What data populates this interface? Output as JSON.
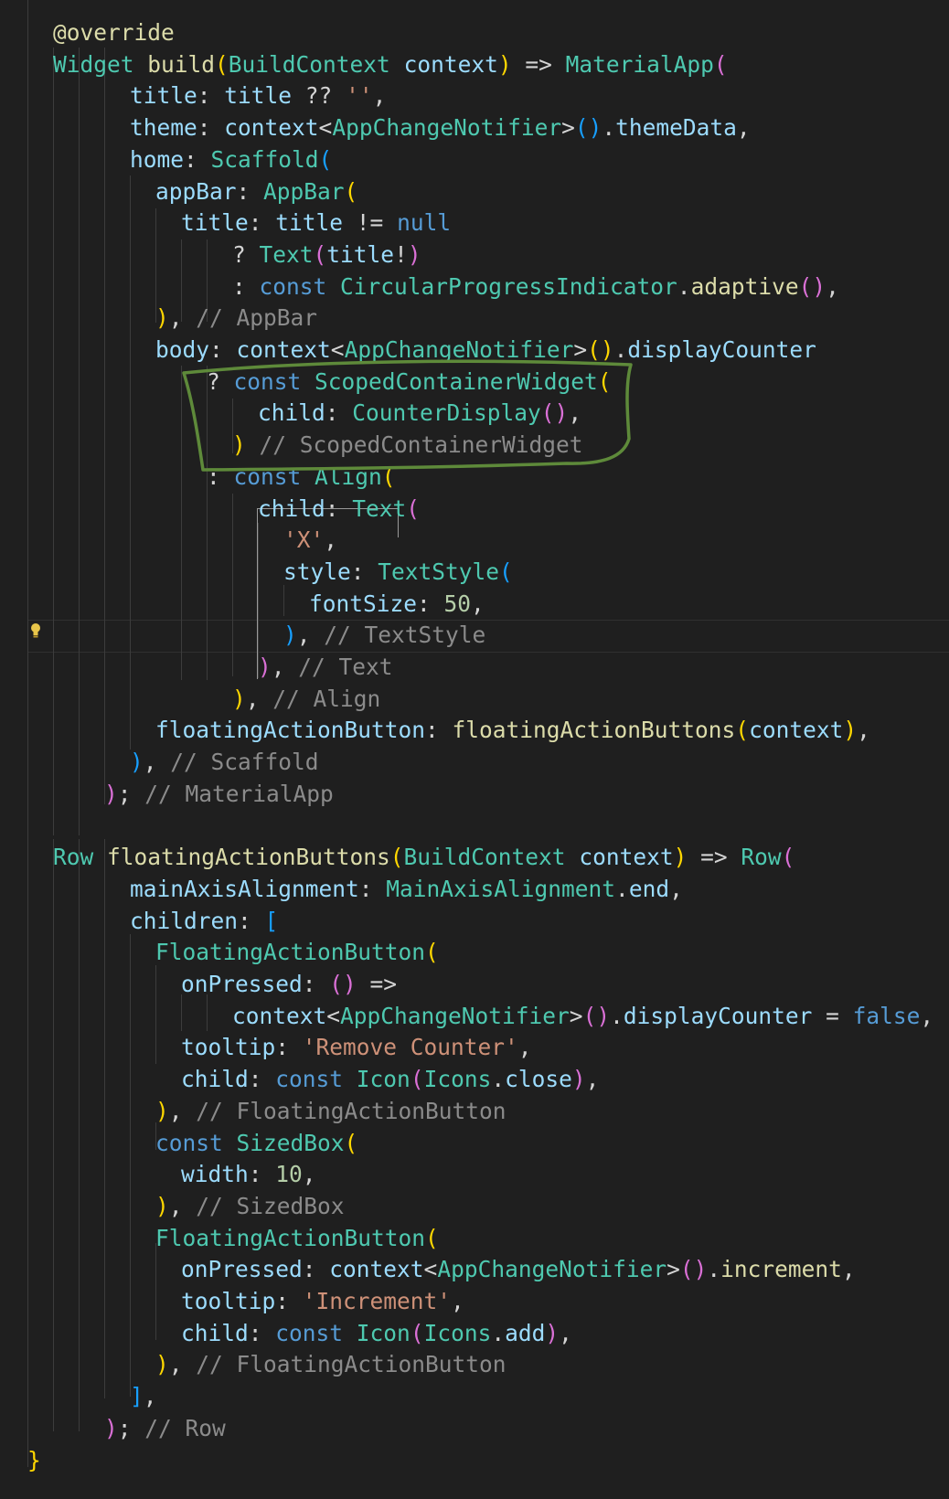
{
  "editor": {
    "language": "dart",
    "colors": {
      "background": "#1f1f1f",
      "keyword": "#569cd6",
      "type": "#4ec9b0",
      "function": "#dcdcaa",
      "variable": "#9cdcfe",
      "string": "#ce9178",
      "number": "#b5cea8",
      "comment": "#8b8b8b",
      "annotation_stroke": "#5e8a3a"
    },
    "lines": [
      [
        [
          "@override",
          "tok-fn"
        ]
      ],
      [
        [
          "Widget ",
          "tok-type"
        ],
        [
          "build",
          "tok-fn"
        ],
        [
          "(",
          "tok-p1"
        ],
        [
          "BuildContext ",
          "tok-type"
        ],
        [
          "context",
          "tok-var"
        ],
        [
          ") ",
          "tok-p1"
        ],
        [
          "=> ",
          "tok-plain"
        ],
        [
          "MaterialApp",
          "tok-type"
        ],
        [
          "(",
          "tok-p2"
        ]
      ],
      [
        [
          "title",
          "tok-var"
        ],
        [
          ": ",
          "tok-plain"
        ],
        [
          "title ",
          "tok-var"
        ],
        [
          "?? ",
          "tok-plain"
        ],
        [
          "''",
          "tok-str"
        ],
        [
          ",",
          "tok-plain"
        ]
      ],
      [
        [
          "theme",
          "tok-var"
        ],
        [
          ": ",
          "tok-plain"
        ],
        [
          "context",
          "tok-var"
        ],
        [
          "<",
          "tok-plain"
        ],
        [
          "AppChangeNotifier",
          "tok-type"
        ],
        [
          ">",
          "tok-plain"
        ],
        [
          "()",
          "tok-p3"
        ],
        [
          ".",
          "tok-plain"
        ],
        [
          "themeData",
          "tok-var"
        ],
        [
          ",",
          "tok-plain"
        ]
      ],
      [
        [
          "home",
          "tok-var"
        ],
        [
          ": ",
          "tok-plain"
        ],
        [
          "Scaffold",
          "tok-type"
        ],
        [
          "(",
          "tok-p3"
        ]
      ],
      [
        [
          "appBar",
          "tok-var"
        ],
        [
          ": ",
          "tok-plain"
        ],
        [
          "AppBar",
          "tok-type"
        ],
        [
          "(",
          "tok-p1"
        ]
      ],
      [
        [
          "title",
          "tok-var"
        ],
        [
          ": ",
          "tok-plain"
        ],
        [
          "title ",
          "tok-var"
        ],
        [
          "!= ",
          "tok-plain"
        ],
        [
          "null",
          "tok-kw"
        ]
      ],
      [
        [
          "? ",
          "tok-plain"
        ],
        [
          "Text",
          "tok-type"
        ],
        [
          "(",
          "tok-p2"
        ],
        [
          "title",
          "tok-var"
        ],
        [
          "!",
          "tok-plain"
        ],
        [
          ")",
          "tok-p2"
        ]
      ],
      [
        [
          ": ",
          "tok-plain"
        ],
        [
          "const ",
          "tok-kw"
        ],
        [
          "CircularProgressIndicator",
          "tok-type"
        ],
        [
          ".",
          "tok-plain"
        ],
        [
          "adaptive",
          "tok-fn"
        ],
        [
          "()",
          "tok-p2"
        ],
        [
          ",",
          "tok-plain"
        ]
      ],
      [
        [
          ")",
          "tok-p1"
        ],
        [
          ", ",
          "tok-plain"
        ],
        [
          "// AppBar",
          "tok-cmt"
        ]
      ],
      [
        [
          "body",
          "tok-var"
        ],
        [
          ": ",
          "tok-plain"
        ],
        [
          "context",
          "tok-var"
        ],
        [
          "<",
          "tok-plain"
        ],
        [
          "AppChangeNotifier",
          "tok-type"
        ],
        [
          ">",
          "tok-plain"
        ],
        [
          "()",
          "tok-p1"
        ],
        [
          ".",
          "tok-plain"
        ],
        [
          "displayCounter",
          "tok-var"
        ]
      ],
      [
        [
          "? ",
          "tok-plain"
        ],
        [
          "const ",
          "tok-kw"
        ],
        [
          "ScopedContainerWidget",
          "tok-type"
        ],
        [
          "(",
          "tok-p1"
        ]
      ],
      [
        [
          "child",
          "tok-var"
        ],
        [
          ": ",
          "tok-plain"
        ],
        [
          "CounterDisplay",
          "tok-type"
        ],
        [
          "()",
          "tok-p2"
        ],
        [
          ",",
          "tok-plain"
        ]
      ],
      [
        [
          ")",
          "tok-p1"
        ],
        [
          " ",
          "tok-plain"
        ],
        [
          "// ScopedContainerWidget",
          "tok-cmt"
        ]
      ],
      [
        [
          ": ",
          "tok-plain"
        ],
        [
          "const ",
          "tok-kw"
        ],
        [
          "Align",
          "tok-type"
        ],
        [
          "(",
          "tok-p1"
        ]
      ],
      [
        [
          "child",
          "tok-var"
        ],
        [
          ": ",
          "tok-plain"
        ],
        [
          "Text",
          "tok-type"
        ],
        [
          "(",
          "tok-p2"
        ]
      ],
      [
        [
          "'X'",
          "tok-str"
        ],
        [
          ",",
          "tok-plain"
        ]
      ],
      [
        [
          "style",
          "tok-var"
        ],
        [
          ": ",
          "tok-plain"
        ],
        [
          "TextStyle",
          "tok-type"
        ],
        [
          "(",
          "tok-p3"
        ]
      ],
      [
        [
          "fontSize",
          "tok-var"
        ],
        [
          ": ",
          "tok-plain"
        ],
        [
          "50",
          "tok-num"
        ],
        [
          ",",
          "tok-plain"
        ]
      ],
      [
        [
          ")",
          "tok-p3"
        ],
        [
          ", ",
          "tok-plain"
        ],
        [
          "// TextStyle",
          "tok-cmt"
        ]
      ],
      [
        [
          ")",
          "tok-p2"
        ],
        [
          ", ",
          "tok-plain"
        ],
        [
          "// Text",
          "tok-cmt"
        ]
      ],
      [
        [
          ")",
          "tok-p1"
        ],
        [
          ", ",
          "tok-plain"
        ],
        [
          "// Align",
          "tok-cmt"
        ]
      ],
      [
        [
          "floatingActionButton",
          "tok-var"
        ],
        [
          ": ",
          "tok-plain"
        ],
        [
          "floatingActionButtons",
          "tok-fn"
        ],
        [
          "(",
          "tok-p1"
        ],
        [
          "context",
          "tok-var"
        ],
        [
          ")",
          "tok-p1"
        ],
        [
          ",",
          "tok-plain"
        ]
      ],
      [
        [
          ")",
          "tok-p3"
        ],
        [
          ", ",
          "tok-plain"
        ],
        [
          "// Scaffold",
          "tok-cmt"
        ]
      ],
      [
        [
          ")",
          "tok-p2"
        ],
        [
          "; ",
          "tok-plain"
        ],
        [
          "// MaterialApp",
          "tok-cmt"
        ]
      ],
      [],
      [
        [
          "Row ",
          "tok-type"
        ],
        [
          "floatingActionButtons",
          "tok-fn"
        ],
        [
          "(",
          "tok-p1"
        ],
        [
          "BuildContext ",
          "tok-type"
        ],
        [
          "context",
          "tok-var"
        ],
        [
          ") ",
          "tok-p1"
        ],
        [
          "=> ",
          "tok-plain"
        ],
        [
          "Row",
          "tok-type"
        ],
        [
          "(",
          "tok-p2"
        ]
      ],
      [
        [
          "mainAxisAlignment",
          "tok-var"
        ],
        [
          ": ",
          "tok-plain"
        ],
        [
          "MainAxisAlignment",
          "tok-type"
        ],
        [
          ".",
          "tok-plain"
        ],
        [
          "end",
          "tok-var"
        ],
        [
          ",",
          "tok-plain"
        ]
      ],
      [
        [
          "children",
          "tok-var"
        ],
        [
          ": ",
          "tok-plain"
        ],
        [
          "[",
          "tok-p3"
        ]
      ],
      [
        [
          "FloatingActionButton",
          "tok-type"
        ],
        [
          "(",
          "tok-p1"
        ]
      ],
      [
        [
          "onPressed",
          "tok-var"
        ],
        [
          ": ",
          "tok-plain"
        ],
        [
          "() ",
          "tok-p2"
        ],
        [
          "=>",
          "tok-plain"
        ]
      ],
      [
        [
          "context",
          "tok-var"
        ],
        [
          "<",
          "tok-plain"
        ],
        [
          "AppChangeNotifier",
          "tok-type"
        ],
        [
          ">",
          "tok-plain"
        ],
        [
          "()",
          "tok-p2"
        ],
        [
          ".",
          "tok-plain"
        ],
        [
          "displayCounter ",
          "tok-var"
        ],
        [
          "= ",
          "tok-plain"
        ],
        [
          "false",
          "tok-kw"
        ],
        [
          ",",
          "tok-plain"
        ]
      ],
      [
        [
          "tooltip",
          "tok-var"
        ],
        [
          ": ",
          "tok-plain"
        ],
        [
          "'Remove Counter'",
          "tok-str"
        ],
        [
          ",",
          "tok-plain"
        ]
      ],
      [
        [
          "child",
          "tok-var"
        ],
        [
          ": ",
          "tok-plain"
        ],
        [
          "const ",
          "tok-kw"
        ],
        [
          "Icon",
          "tok-type"
        ],
        [
          "(",
          "tok-p2"
        ],
        [
          "Icons",
          "tok-type"
        ],
        [
          ".",
          "tok-plain"
        ],
        [
          "close",
          "tok-var"
        ],
        [
          ")",
          "tok-p2"
        ],
        [
          ",",
          "tok-plain"
        ]
      ],
      [
        [
          ")",
          "tok-p1"
        ],
        [
          ", ",
          "tok-plain"
        ],
        [
          "// FloatingActionButton",
          "tok-cmt"
        ]
      ],
      [
        [
          "const ",
          "tok-kw"
        ],
        [
          "SizedBox",
          "tok-type"
        ],
        [
          "(",
          "tok-p1"
        ]
      ],
      [
        [
          "width",
          "tok-var"
        ],
        [
          ": ",
          "tok-plain"
        ],
        [
          "10",
          "tok-num"
        ],
        [
          ",",
          "tok-plain"
        ]
      ],
      [
        [
          ")",
          "tok-p1"
        ],
        [
          ", ",
          "tok-plain"
        ],
        [
          "// SizedBox",
          "tok-cmt"
        ]
      ],
      [
        [
          "FloatingActionButton",
          "tok-type"
        ],
        [
          "(",
          "tok-p1"
        ]
      ],
      [
        [
          "onPressed",
          "tok-var"
        ],
        [
          ": ",
          "tok-plain"
        ],
        [
          "context",
          "tok-var"
        ],
        [
          "<",
          "tok-plain"
        ],
        [
          "AppChangeNotifier",
          "tok-type"
        ],
        [
          ">",
          "tok-plain"
        ],
        [
          "()",
          "tok-p2"
        ],
        [
          ".",
          "tok-plain"
        ],
        [
          "increment",
          "tok-fn"
        ],
        [
          ",",
          "tok-plain"
        ]
      ],
      [
        [
          "tooltip",
          "tok-var"
        ],
        [
          ": ",
          "tok-plain"
        ],
        [
          "'Increment'",
          "tok-str"
        ],
        [
          ",",
          "tok-plain"
        ]
      ],
      [
        [
          "child",
          "tok-var"
        ],
        [
          ": ",
          "tok-plain"
        ],
        [
          "const ",
          "tok-kw"
        ],
        [
          "Icon",
          "tok-type"
        ],
        [
          "(",
          "tok-p2"
        ],
        [
          "Icons",
          "tok-type"
        ],
        [
          ".",
          "tok-plain"
        ],
        [
          "add",
          "tok-var"
        ],
        [
          ")",
          "tok-p2"
        ],
        [
          ",",
          "tok-plain"
        ]
      ],
      [
        [
          ")",
          "tok-p1"
        ],
        [
          ", ",
          "tok-plain"
        ],
        [
          "// FloatingActionButton",
          "tok-cmt"
        ]
      ],
      [
        [
          "]",
          "tok-p3"
        ],
        [
          ",",
          "tok-plain"
        ]
      ],
      [
        [
          ")",
          "tok-p2"
        ],
        [
          "; ",
          "tok-plain"
        ],
        [
          "// Row",
          "tok-cmt"
        ]
      ],
      [
        [
          "}",
          "tok-p1"
        ]
      ]
    ]
  }
}
